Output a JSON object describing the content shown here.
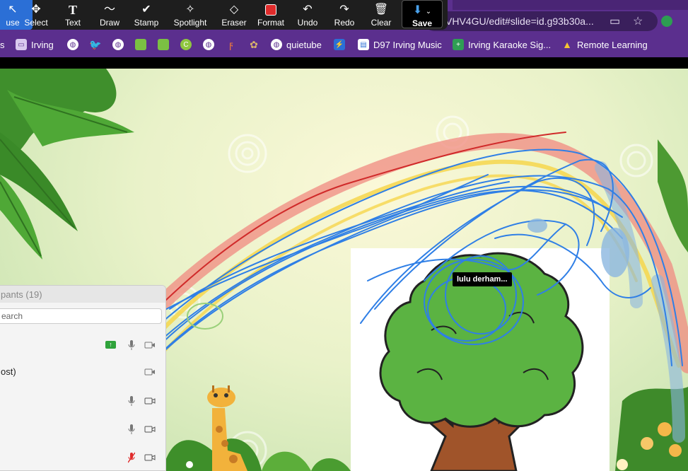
{
  "toolbar": {
    "tools": [
      {
        "label": "use",
        "icon": "mouse-pointer-icon"
      },
      {
        "label": "Select",
        "icon": "move-icon"
      },
      {
        "label": "Text",
        "icon": "text-icon"
      },
      {
        "label": "Draw",
        "icon": "draw-icon"
      },
      {
        "label": "Stamp",
        "icon": "stamp-icon"
      },
      {
        "label": "Spotlight",
        "icon": "spotlight-icon"
      },
      {
        "label": "Eraser",
        "icon": "eraser-icon"
      },
      {
        "label": "Format",
        "icon": "format-icon"
      },
      {
        "label": "Undo",
        "icon": "undo-icon"
      },
      {
        "label": "Redo",
        "icon": "redo-icon"
      },
      {
        "label": "Clear",
        "icon": "clear-icon"
      },
      {
        "label": "Save",
        "icon": "save-icon"
      }
    ],
    "format_color": "#e02b2b"
  },
  "browser": {
    "url": "VHV4GU/edit#slide=id.g93b30a..."
  },
  "bookmarks": [
    {
      "label": "s",
      "icon": "none"
    },
    {
      "label": "Irving",
      "icon": "folder-icon"
    },
    {
      "label": "",
      "icon": "globe-icon"
    },
    {
      "label": "",
      "icon": "twitter-icon"
    },
    {
      "label": "",
      "icon": "globe-icon"
    },
    {
      "label": "",
      "icon": "app-icon"
    },
    {
      "label": "",
      "icon": "image-icon"
    },
    {
      "label": "",
      "icon": "c-icon"
    },
    {
      "label": "",
      "icon": "globe-icon"
    },
    {
      "label": "",
      "icon": "f-icon"
    },
    {
      "label": "",
      "icon": "paw-icon"
    },
    {
      "label": "quietube",
      "icon": "globe-icon"
    },
    {
      "label": "",
      "icon": "bolt-icon"
    },
    {
      "label": "D97 Irving Music",
      "icon": "calendar-icon"
    },
    {
      "label": "Irving Karaoke Sig...",
      "icon": "plus-icon"
    },
    {
      "label": "Remote Learning",
      "icon": "drive-icon"
    }
  ],
  "participants": {
    "title": "pants (19)",
    "search_placeholder": "earch",
    "rows": [
      {
        "name": "",
        "mic": "on",
        "cam": "off",
        "sharing": true
      },
      {
        "name": "ost)",
        "mic": "none",
        "cam": "off",
        "sharing": false
      },
      {
        "name": "",
        "mic": "on",
        "cam": "on",
        "sharing": false
      },
      {
        "name": "",
        "mic": "on",
        "cam": "on",
        "sharing": false
      },
      {
        "name": "",
        "mic": "muted",
        "cam": "on",
        "sharing": false
      }
    ]
  },
  "annotation_label": "lulu derham..."
}
